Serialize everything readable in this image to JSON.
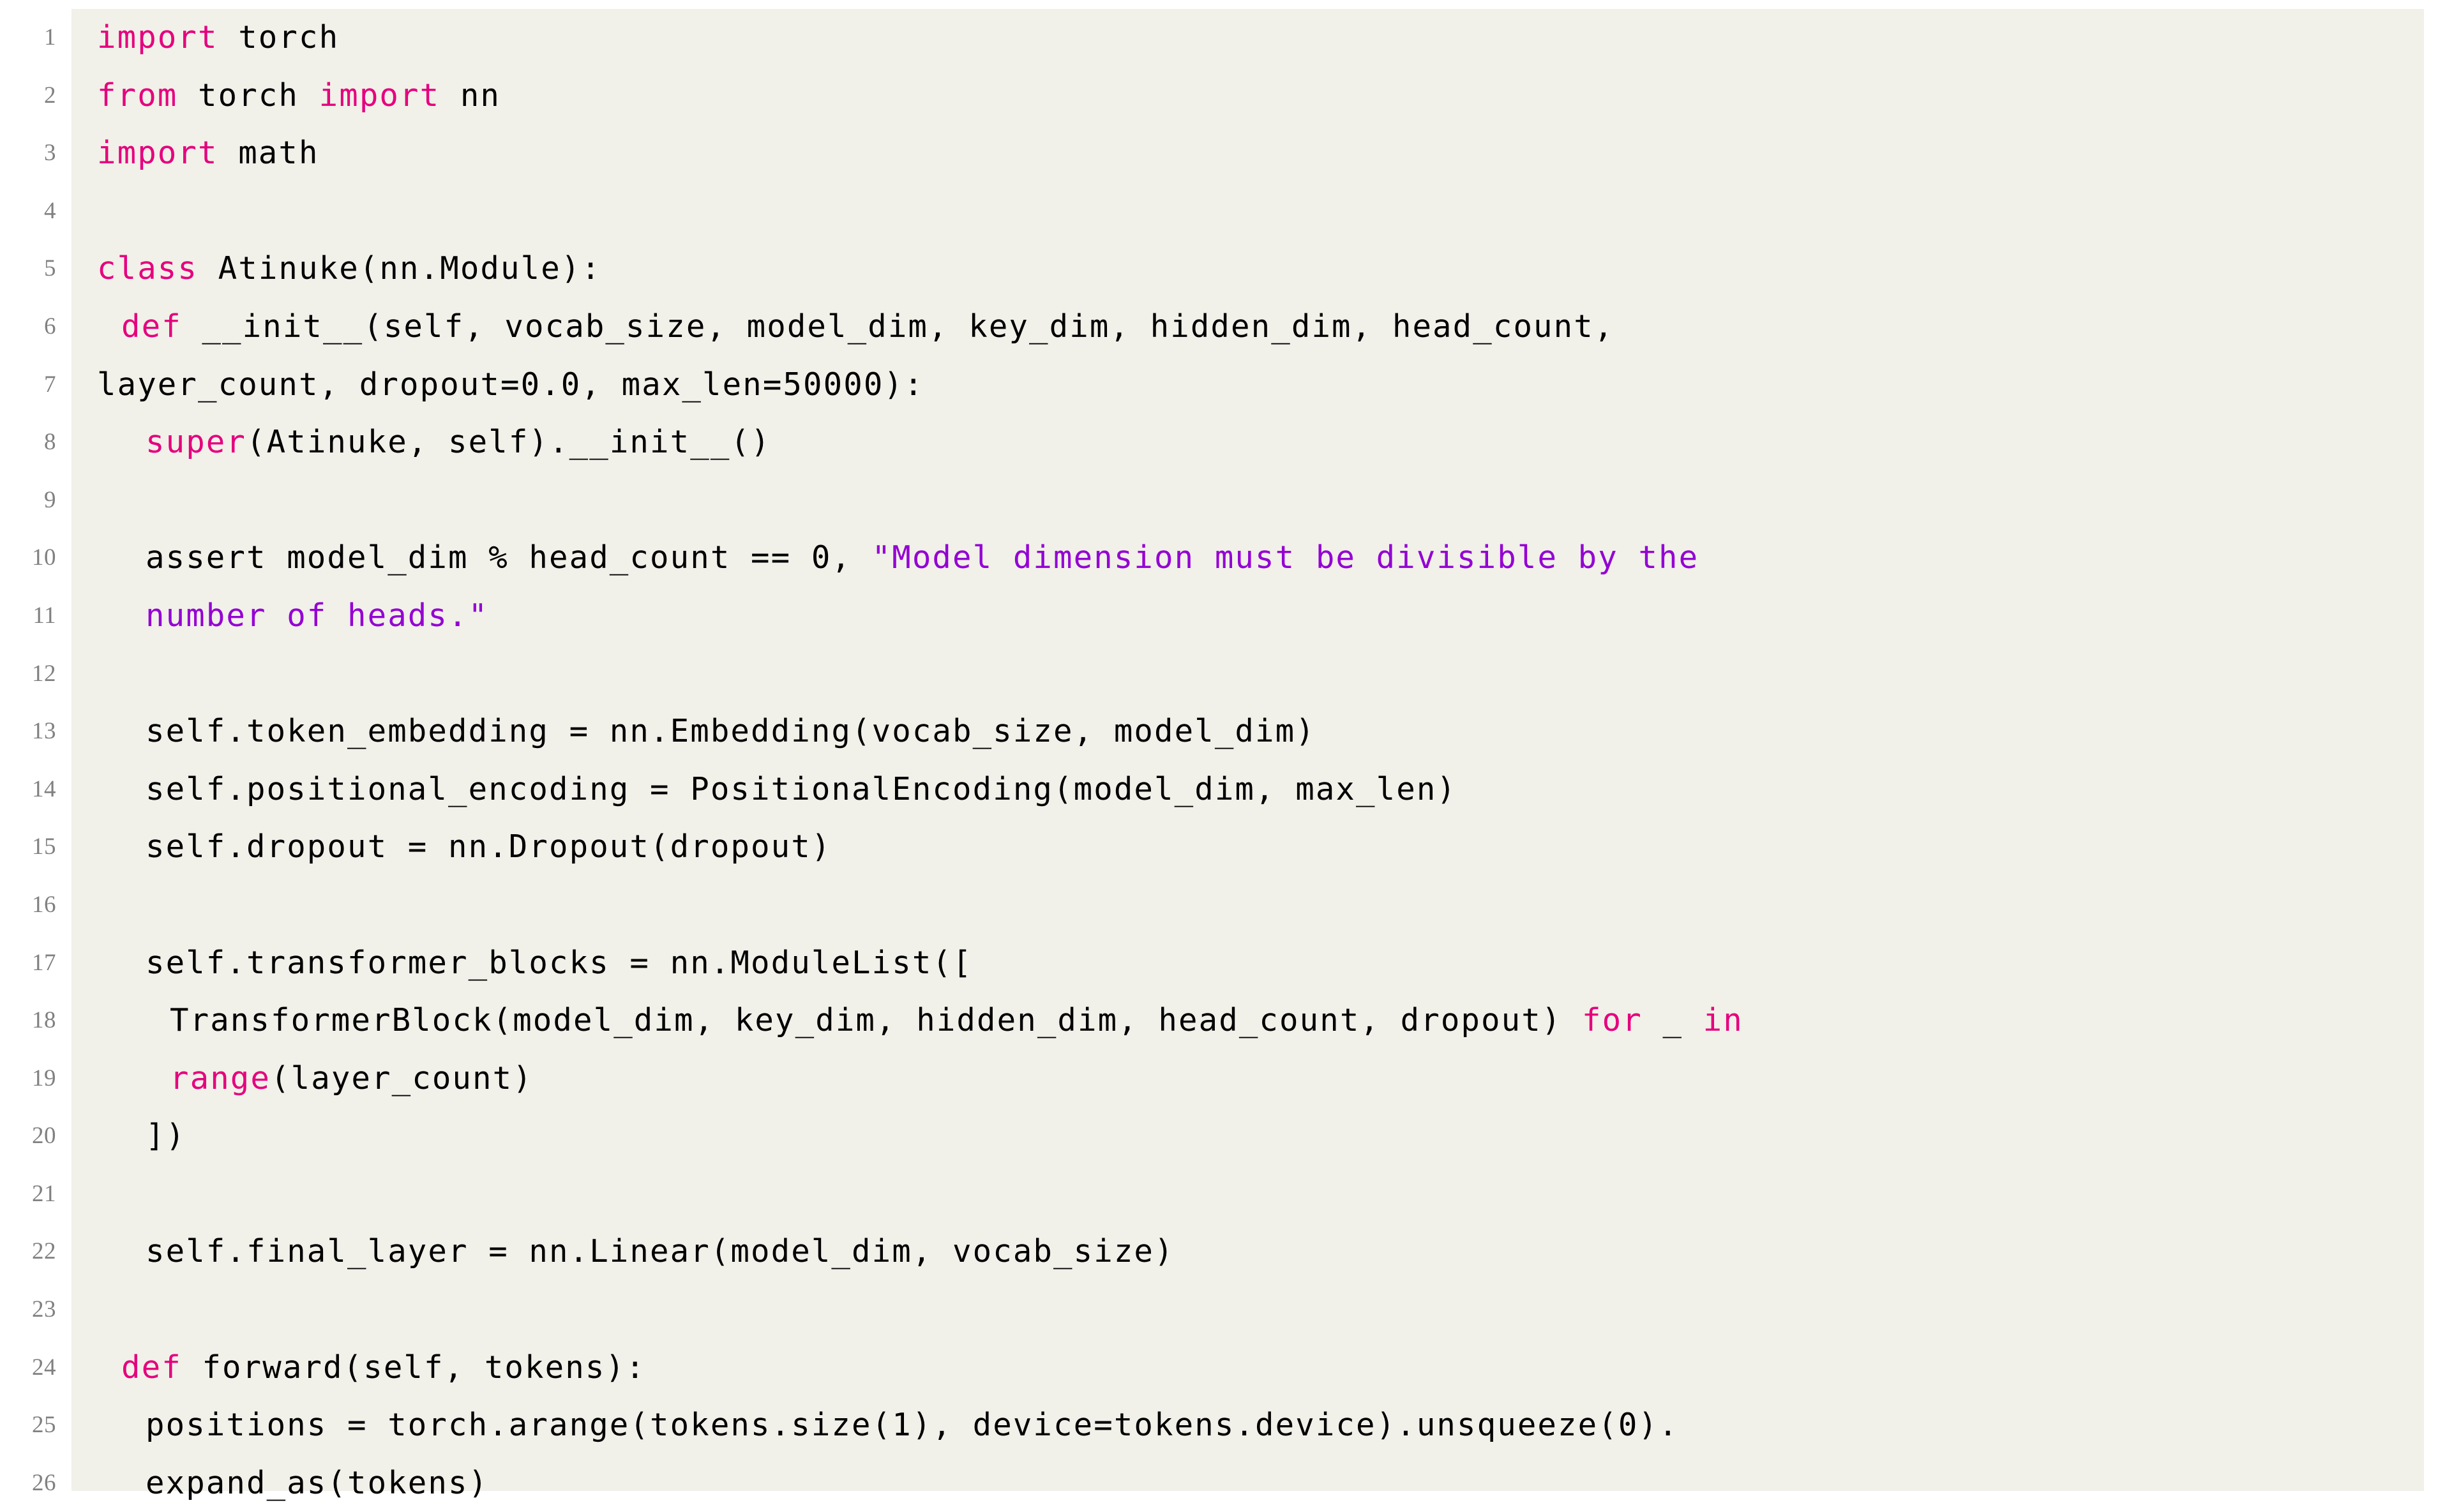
{
  "listing": {
    "language": "python",
    "background_color": "#f1f0e9",
    "page_color": "#ffffff",
    "keyword_color": "#e5007d",
    "string_color": "#9400d3",
    "text_color": "#000000",
    "lineno_color": "#808080",
    "first_line_number": 1,
    "last_line_number": 26,
    "line_numbers": [
      "1",
      "2",
      "3",
      "4",
      "5",
      "6",
      "7",
      "8",
      "9",
      "10",
      "11",
      "12",
      "13",
      "14",
      "15",
      "16",
      "17",
      "18",
      "19",
      "20",
      "21",
      "22",
      "23",
      "24",
      "25",
      "26"
    ],
    "lines": [
      {
        "n": "1",
        "indent": 0,
        "tokens": [
          {
            "t": "import",
            "c": "k"
          },
          {
            "t": " torch",
            "c": "n"
          }
        ]
      },
      {
        "n": "2",
        "indent": 0,
        "tokens": [
          {
            "t": "from",
            "c": "k"
          },
          {
            "t": " torch ",
            "c": "n"
          },
          {
            "t": "import",
            "c": "k"
          },
          {
            "t": " nn",
            "c": "n"
          }
        ]
      },
      {
        "n": "3",
        "indent": 0,
        "tokens": [
          {
            "t": "import",
            "c": "k"
          },
          {
            "t": " math",
            "c": "n"
          }
        ]
      },
      {
        "n": "4",
        "indent": 0,
        "tokens": []
      },
      {
        "n": "5",
        "indent": 0,
        "tokens": [
          {
            "t": "class",
            "c": "k"
          },
          {
            "t": " Atinuke(nn.Module):",
            "c": "n"
          }
        ]
      },
      {
        "n": "6",
        "indent": 1,
        "tokens": [
          {
            "t": "def",
            "c": "k"
          },
          {
            "t": " __init__(self, vocab_size, model_dim, key_dim, hidden_dim, head_count,",
            "c": "n"
          }
        ]
      },
      {
        "n": "7",
        "indent": 0,
        "tokens": [
          {
            "t": "layer_count, dropout=0.0, max_len=50000):",
            "c": "n"
          }
        ]
      },
      {
        "n": "8",
        "indent": 2,
        "tokens": [
          {
            "t": "super",
            "c": "k"
          },
          {
            "t": "(Atinuke, self).__init__()",
            "c": "n"
          }
        ]
      },
      {
        "n": "9",
        "indent": 0,
        "tokens": []
      },
      {
        "n": "10",
        "indent": 2,
        "tokens": [
          {
            "t": "assert model_dim % head_count == 0, ",
            "c": "n"
          },
          {
            "t": "\"Model dimension must be divisible by the",
            "c": "s"
          }
        ]
      },
      {
        "n": "11",
        "indent": 2,
        "tokens": [
          {
            "t": "number of heads.\"",
            "c": "s"
          }
        ]
      },
      {
        "n": "12",
        "indent": 0,
        "tokens": []
      },
      {
        "n": "13",
        "indent": 2,
        "tokens": [
          {
            "t": "self.token_embedding = nn.Embedding(vocab_size, model_dim)",
            "c": "n"
          }
        ]
      },
      {
        "n": "14",
        "indent": 2,
        "tokens": [
          {
            "t": "self.positional_encoding = PositionalEncoding(model_dim, max_len)",
            "c": "n"
          }
        ]
      },
      {
        "n": "15",
        "indent": 2,
        "tokens": [
          {
            "t": "self.dropout = nn.Dropout(dropout)",
            "c": "n"
          }
        ]
      },
      {
        "n": "16",
        "indent": 0,
        "tokens": []
      },
      {
        "n": "17",
        "indent": 2,
        "tokens": [
          {
            "t": "self.transformer_blocks = nn.ModuleList([",
            "c": "n"
          }
        ]
      },
      {
        "n": "18",
        "indent": 3,
        "tokens": [
          {
            "t": "TransformerBlock(model_dim, key_dim, hidden_dim, head_count, dropout) ",
            "c": "n"
          },
          {
            "t": "for",
            "c": "k"
          },
          {
            "t": " _ ",
            "c": "n"
          },
          {
            "t": "in",
            "c": "k"
          }
        ]
      },
      {
        "n": "19",
        "indent": 3,
        "tokens": [
          {
            "t": "range",
            "c": "k"
          },
          {
            "t": "(layer_count)",
            "c": "n"
          }
        ]
      },
      {
        "n": "20",
        "indent": 2,
        "tokens": [
          {
            "t": "])",
            "c": "n"
          }
        ]
      },
      {
        "n": "21",
        "indent": 0,
        "tokens": []
      },
      {
        "n": "22",
        "indent": 2,
        "tokens": [
          {
            "t": "self.final_layer = nn.Linear(model_dim, vocab_size)",
            "c": "n"
          }
        ]
      },
      {
        "n": "23",
        "indent": 0,
        "tokens": []
      },
      {
        "n": "24",
        "indent": 1,
        "tokens": [
          {
            "t": "def",
            "c": "k"
          },
          {
            "t": " forward(self, tokens):",
            "c": "n"
          }
        ]
      },
      {
        "n": "25",
        "indent": 2,
        "tokens": [
          {
            "t": "positions = torch.arange(tokens.size(1), device=tokens.device).unsqueeze(0).",
            "c": "n"
          }
        ]
      },
      {
        "n": "26",
        "indent": 2,
        "tokens": [
          {
            "t": "expand_as(tokens)",
            "c": "n"
          }
        ]
      }
    ]
  }
}
